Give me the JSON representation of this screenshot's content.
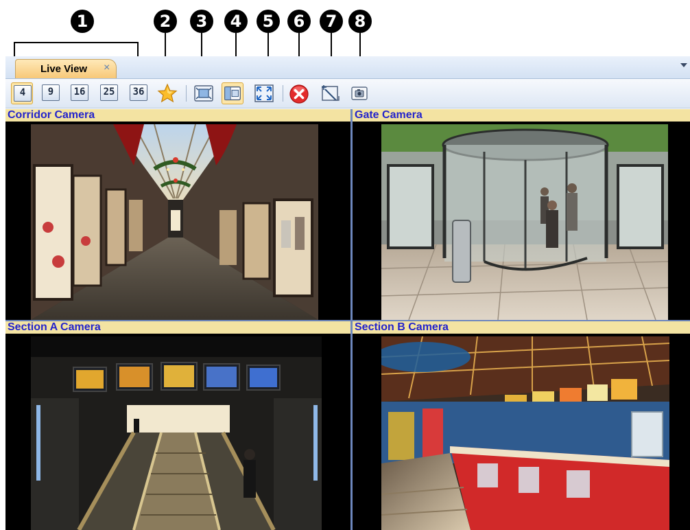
{
  "callouts": {
    "labels": [
      "1",
      "2",
      "3",
      "4",
      "5",
      "6",
      "7",
      "8"
    ]
  },
  "tab": {
    "label": "Live View",
    "close_glyph": "×"
  },
  "toolbar": {
    "grid_buttons": [
      "4",
      "9",
      "16",
      "25",
      "36"
    ],
    "icons": [
      "favorite-star-icon",
      "fit-frame-icon",
      "frame-size-icon",
      "fullscreen-icon",
      "close-all-icon",
      "select-area-icon",
      "snapshot-icon"
    ]
  },
  "cameras": [
    {
      "title": "Corridor Camera"
    },
    {
      "title": "Gate Camera"
    },
    {
      "title": "Section A Camera"
    },
    {
      "title": "Section B Camera"
    }
  ],
  "colors": {
    "title_bar": "#f3e3a2",
    "title_text": "#2323cc",
    "active_button": "#fde6a8",
    "close_red": "#e32b2b"
  }
}
